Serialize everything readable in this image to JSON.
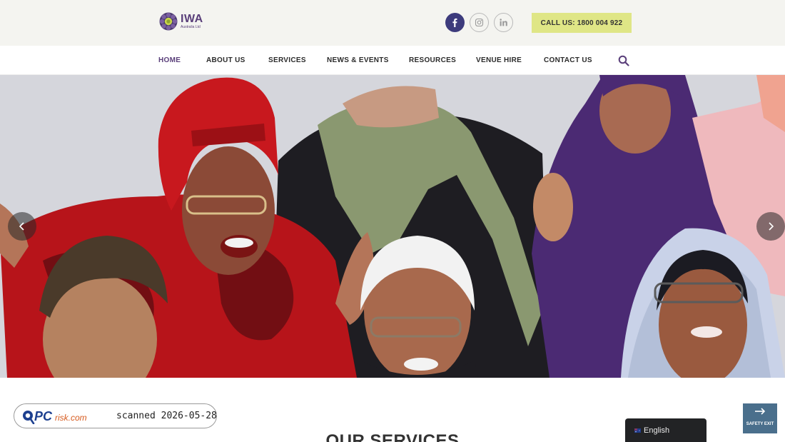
{
  "header": {
    "logo": {
      "name": "IWA",
      "subtitle": "Australia Ltd"
    },
    "social": [
      {
        "icon": "facebook-icon"
      },
      {
        "icon": "instagram-icon"
      },
      {
        "icon": "linkedin-icon"
      }
    ],
    "call_button": "CALL US: 1800 004 922",
    "colors": {
      "brand_purple": "#5a3f7a",
      "call_button_bg": "#dfe686",
      "facebook_bg": "#3d3b7c",
      "topbar_bg": "#f4f4f0"
    }
  },
  "nav": {
    "items": [
      {
        "label": "HOME",
        "active": true
      },
      {
        "label": "ABOUT US",
        "active": false
      },
      {
        "label": "SERVICES",
        "active": false
      },
      {
        "label": "NEWS & EVENTS",
        "active": false
      },
      {
        "label": "RESOURCES",
        "active": false
      },
      {
        "label": "VENUE HIRE",
        "active": false
      },
      {
        "label": "CONTACT US",
        "active": false
      }
    ],
    "search_icon": "search-icon"
  },
  "hero": {
    "prev_icon": "chevron-left-icon",
    "next_icon": "chevron-right-icon"
  },
  "main": {
    "section_title": "OUR SERVICES"
  },
  "watermark": {
    "brand": "PCrisk.com",
    "text": "scanned 2026-05-28"
  },
  "language": {
    "label": "English",
    "flag_icon": "australia-flag-icon"
  },
  "safety_exit": {
    "label": "SAFETY EXIT",
    "icon": "arrow-right-icon",
    "color": "#4a6f8c"
  }
}
